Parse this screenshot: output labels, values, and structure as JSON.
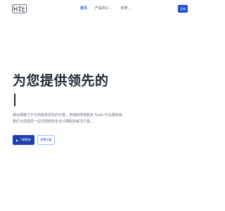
{
  "header": {
    "logo_text": "和云网",
    "nav": [
      {
        "label": "首页",
        "has_dropdown": false,
        "active": true
      },
      {
        "label": "产品中心",
        "has_dropdown": true,
        "active": false
      },
      {
        "label": "支持",
        "has_dropdown": true,
        "active": false
      }
    ],
    "register_label": "注册"
  },
  "hero": {
    "title": "为您提供领先的",
    "description_line1": "微云网致力于为您提供领先的计算、存储和网络服务 SaaS 平台服务商,",
    "description_line2": "我们为您提供一站式网络安全云计算服务解决方案。",
    "primary_button": "了解更多",
    "secondary_button": "免费注册"
  },
  "colors": {
    "accent": "#2563eb",
    "button_primary": "#1e40af",
    "text_dark": "#1f2937",
    "text_muted": "#6b7280"
  }
}
